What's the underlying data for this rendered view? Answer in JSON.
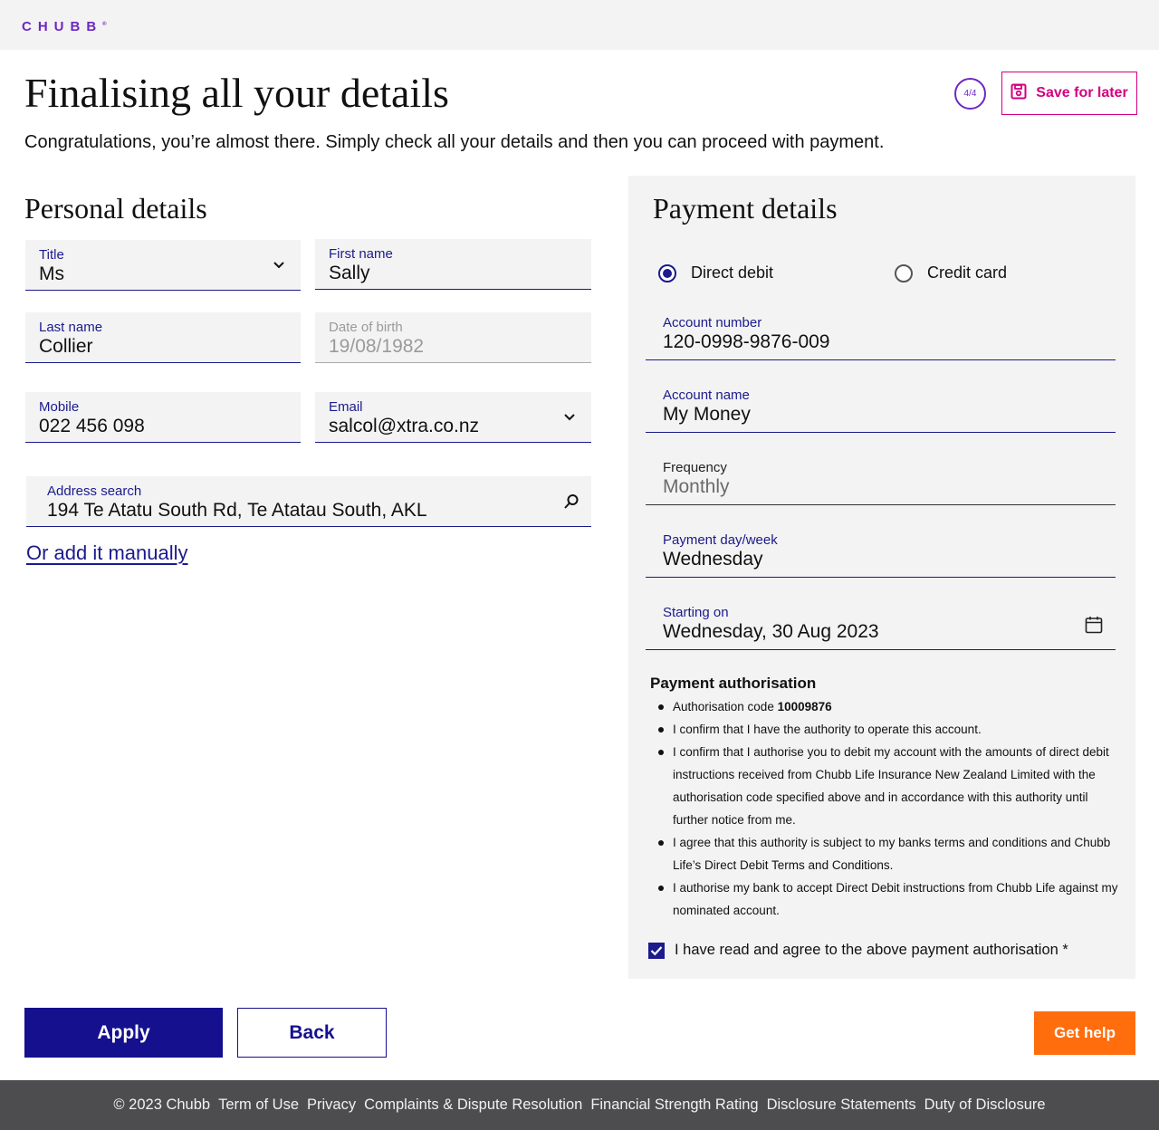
{
  "brand": {
    "logo_text": "CHUBB",
    "logo_mark": "®",
    "accent": "#6e27c5",
    "primary": "#15108e",
    "pink": "#d4007f",
    "orange": "#ff6d0d"
  },
  "header": {
    "title": "Finalising all your details",
    "intro": "Congratulations, you’re almost there. Simply check all your details and then you can proceed with payment.",
    "progress": "4/4",
    "save_label": "Save for later"
  },
  "personal": {
    "section_title": "Personal details",
    "title_label": "Title",
    "title_value": "Ms",
    "first_name_label": "First name",
    "first_name_value": "Sally",
    "last_name_label": "Last name",
    "last_name_value": "Collier",
    "dob_label": "Date of birth",
    "dob_value": "19/08/1982",
    "mobile_label": "Mobile",
    "mobile_value": "022 456 098",
    "email_label": "Email",
    "email_value": "salcol@xtra.co.nz",
    "address_label": "Address search",
    "address_value": "194 Te Atatu South Rd, Te Atatau South, AKL",
    "manual_link": "Or add it manually"
  },
  "payment": {
    "section_title": "Payment details",
    "method_direct": "Direct debit",
    "method_card": "Credit card",
    "selected_method": "Direct debit",
    "account_number_label": "Account number",
    "account_number_value": "120-0998-9876-009",
    "account_name_label": "Account name",
    "account_name_value": "My Money",
    "frequency_label": "Frequency",
    "frequency_value": "Monthly",
    "payment_day_label": "Payment day/week",
    "payment_day_value": "Wednesday",
    "starting_label": "Starting on",
    "starting_value": "Wednesday, 30 Aug 2023"
  },
  "authorisation": {
    "title": "Payment authorisation",
    "code_prefix": "Authorisation code ",
    "code": "10009876",
    "items": [
      "I confirm that I have the authority to operate this account.",
      "I confirm that I authorise you to debit my account with the amounts of direct debit instructions received from Chubb Life Insurance New Zealand Limited with the authorisation code specified above and in accordance with this authority until further notice from me.",
      "I agree that this authority is subject to my banks terms and conditions and Chubb Life’s Direct Debit Terms and Conditions.",
      "I authorise my bank to accept Direct Debit instructions from Chubb Life against my nominated account."
    ],
    "agree_label": "I have read and agree to the above payment authorisation *",
    "agreed": true
  },
  "actions": {
    "apply": "Apply",
    "back": "Back",
    "help": "Get help"
  },
  "footer": {
    "links": [
      "© 2023 Chubb",
      "Term of Use",
      "Privacy",
      "Complaints & Dispute Resolution",
      "Financial Strength Rating",
      "Disclosure Statements",
      "Duty of Disclosure"
    ]
  }
}
